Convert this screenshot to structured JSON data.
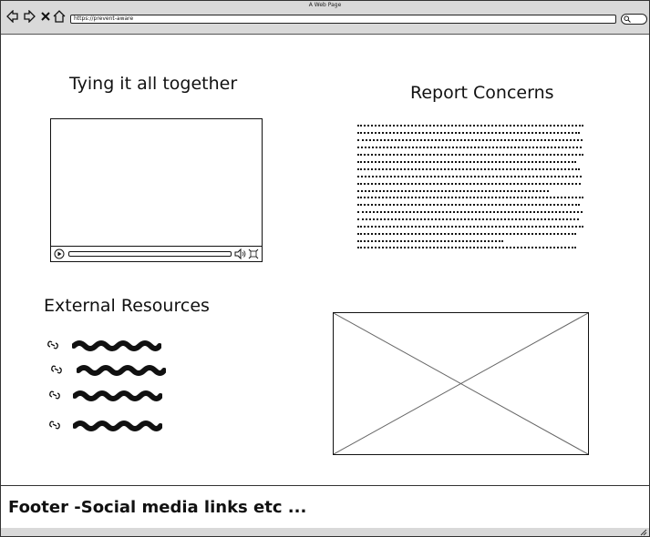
{
  "browser": {
    "window_title": "A Web Page",
    "url": "https://prevent-aware"
  },
  "sections": {
    "video": {
      "heading": "Tying it all together"
    },
    "report": {
      "heading": "Report Concerns"
    },
    "resources": {
      "heading": "External Resources",
      "links": [
        {
          "icon": "link-icon",
          "label": ""
        },
        {
          "icon": "link-icon",
          "label": ""
        },
        {
          "icon": "link-icon",
          "label": ""
        },
        {
          "icon": "link-icon",
          "label": ""
        }
      ]
    }
  },
  "footer": {
    "text": "Footer -Social media links etc  ..."
  }
}
